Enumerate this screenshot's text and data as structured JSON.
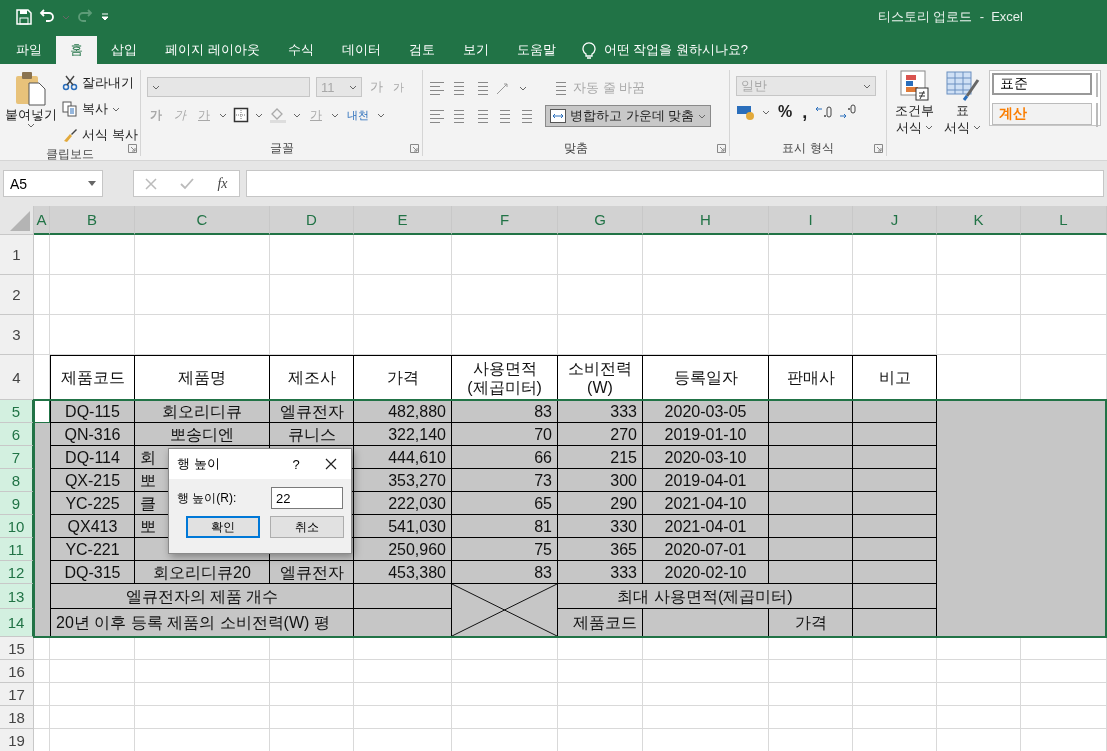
{
  "title_bar": {
    "title": "티스토리 업로드  -  Excel"
  },
  "tabs": [
    {
      "label": "파일",
      "selected": false
    },
    {
      "label": "홈",
      "selected": true
    },
    {
      "label": "삽입",
      "selected": false
    },
    {
      "label": "페이지 레이아웃",
      "selected": false
    },
    {
      "label": "수식",
      "selected": false
    },
    {
      "label": "데이터",
      "selected": false
    },
    {
      "label": "검토",
      "selected": false
    },
    {
      "label": "보기",
      "selected": false
    },
    {
      "label": "도움말",
      "selected": false
    }
  ],
  "tell_me": "어떤 작업을 원하시나요?",
  "ribbon": {
    "clipboard": {
      "label": "클립보드",
      "paste": "붙여넣기",
      "cut": "잘라내기",
      "copy": "복사",
      "format_painter": "서식 복사"
    },
    "font": {
      "label": "글꼴",
      "disabled": true,
      "size": "11",
      "grow": "가",
      "shrink": "가",
      "bold": "가",
      "italic": "가",
      "underline": "가",
      "font_color": "가",
      "phonetic": "내천"
    },
    "alignment": {
      "label": "맞춤",
      "wrap": "자동 줄 바꿈",
      "wrap_disabled": true,
      "merge": "병합하고 가운데 맞춤"
    },
    "number": {
      "label": "표시 형식",
      "format": "일반",
      "percent": "%",
      "comma": ","
    },
    "styles": {
      "conditional": "조건부",
      "conditional_2": "서식",
      "table": "표",
      "table_2": "서식",
      "normal": "표준",
      "calculation": "계산"
    }
  },
  "formula_bar": {
    "name_box": "A5",
    "fx": "fx"
  },
  "sheet": {
    "columns": [
      {
        "label": "A",
        "selected": true
      },
      {
        "label": "B",
        "selected": true
      },
      {
        "label": "C",
        "selected": true
      },
      {
        "label": "D",
        "selected": true
      },
      {
        "label": "E",
        "selected": true
      },
      {
        "label": "F",
        "selected": true
      },
      {
        "label": "G",
        "selected": true
      },
      {
        "label": "H",
        "selected": true
      },
      {
        "label": "I",
        "selected": true
      },
      {
        "label": "J",
        "selected": true
      },
      {
        "label": "K",
        "selected": true
      },
      {
        "label": "L",
        "selected": true
      }
    ],
    "rows": [
      {
        "label": "1",
        "selected": false
      },
      {
        "label": "2",
        "selected": false
      },
      {
        "label": "3",
        "selected": false
      },
      {
        "label": "4",
        "selected": false,
        "cells": [
          {
            "text": "제품코드"
          },
          {
            "text": "제품명"
          },
          {
            "text": "제조사"
          },
          {
            "text": "가격"
          },
          {
            "text": "사용면적\n(제곱미터)"
          },
          {
            "text": "소비전력\n(W)"
          },
          {
            "text": "등록일자"
          },
          {
            "text": "판매사"
          },
          {
            "text": "비고"
          }
        ]
      },
      {
        "label": "5",
        "selected": true,
        "active": true,
        "cells": [
          {
            "text": "DQ-115"
          },
          {
            "text": "회오리디큐"
          },
          {
            "text": "엘큐전자"
          },
          {
            "text": "482,880"
          },
          {
            "text": "83"
          },
          {
            "text": "333"
          },
          {
            "text": "2020-03-05"
          },
          {},
          {}
        ]
      },
      {
        "label": "6",
        "selected": true,
        "cells": [
          {
            "text": "QN-316"
          },
          {
            "text": "뽀송디엔"
          },
          {
            "text": "큐니스"
          },
          {
            "text": "322,140"
          },
          {
            "text": "70"
          },
          {
            "text": "270"
          },
          {
            "text": "2019-01-10"
          },
          {},
          {}
        ]
      },
      {
        "label": "7",
        "selected": true,
        "cells": [
          {
            "text": "DQ-114"
          },
          {
            "text": "회",
            "kind": "partial"
          },
          {},
          {
            "text": "444,610"
          },
          {
            "text": "66"
          },
          {
            "text": "215"
          },
          {
            "text": "2020-03-10"
          },
          {},
          {}
        ]
      },
      {
        "label": "8",
        "selected": true,
        "cells": [
          {
            "text": "QX-215"
          },
          {
            "text": "뽀",
            "kind": "partial"
          },
          {},
          {
            "text": "353,270"
          },
          {
            "text": "73"
          },
          {
            "text": "300"
          },
          {
            "text": "2019-04-01"
          },
          {},
          {}
        ]
      },
      {
        "label": "9",
        "selected": true,
        "cells": [
          {
            "text": "YC-225"
          },
          {
            "text": "클",
            "kind": "partial"
          },
          {},
          {
            "text": "222,030"
          },
          {
            "text": "65"
          },
          {
            "text": "290"
          },
          {
            "text": "2021-04-10"
          },
          {},
          {}
        ]
      },
      {
        "label": "10",
        "selected": true,
        "cells": [
          {
            "text": "QX413"
          },
          {
            "text": "뽀",
            "kind": "partial"
          },
          {},
          {
            "text": "541,030"
          },
          {
            "text": "81"
          },
          {
            "text": "330"
          },
          {
            "text": "2021-04-01"
          },
          {},
          {}
        ]
      },
      {
        "label": "11",
        "selected": true,
        "cells": [
          {
            "text": "YC-221"
          },
          {},
          {},
          {
            "text": "250,960"
          },
          {
            "text": "75"
          },
          {
            "text": "365"
          },
          {
            "text": "2020-07-01"
          },
          {},
          {}
        ]
      },
      {
        "label": "12",
        "selected": true,
        "cells": [
          {
            "text": "DQ-315"
          },
          {
            "text": "회오리디큐20"
          },
          {
            "text": "엘큐전자"
          },
          {
            "text": "453,380"
          },
          {
            "text": "83"
          },
          {
            "text": "333"
          },
          {
            "text": "2020-02-10"
          },
          {},
          {}
        ]
      },
      {
        "label": "13",
        "selected": true,
        "cells": [
          {
            "text": "엘큐전자의 제품 개수",
            "kind": "merged"
          },
          {},
          {
            "kind": "cross"
          },
          {
            "text": "최대 사용면적(제곱미터)",
            "kind": "merged"
          },
          {}
        ]
      },
      {
        "label": "14",
        "selected": true,
        "cells": [
          {
            "text": "20년 이후 등록 제품의 소비전력(W) 평",
            "kind": "merged"
          },
          {},
          {
            "text": "제품코드"
          },
          {},
          {
            "text": "가격"
          },
          {}
        ]
      },
      {
        "label": "15",
        "selected": false
      },
      {
        "label": "16",
        "selected": false
      },
      {
        "label": "17",
        "selected": false
      },
      {
        "label": "18",
        "selected": false
      },
      {
        "label": "19",
        "selected": false
      }
    ]
  },
  "dialog": {
    "title": "행 높이",
    "help": "?",
    "label": "행 높이(R):",
    "value": "22",
    "ok": "확인",
    "cancel": "취소"
  }
}
